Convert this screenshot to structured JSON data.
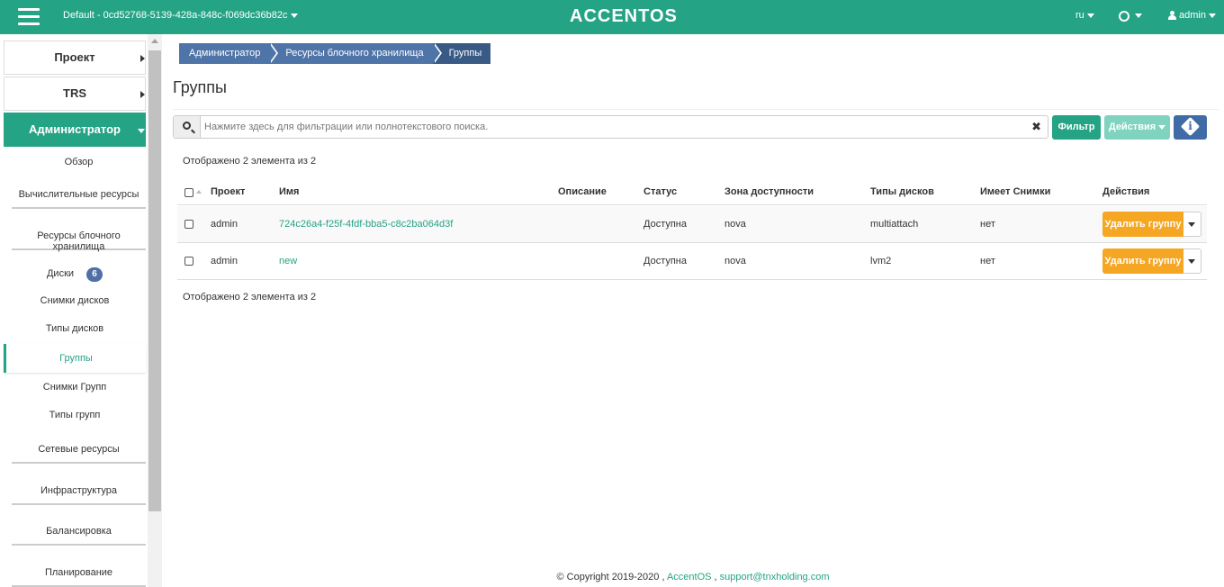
{
  "header": {
    "project_label": "Default - 0cd52768-5139-428a-848c-f069dc36b82c",
    "logo": "ACCENTOS",
    "lang": "ru",
    "user": "admin",
    "brand_color": "#25a385"
  },
  "sidebar": {
    "main_items": [
      {
        "label": "Проект"
      },
      {
        "label": "TRS"
      },
      {
        "label": "Администратор"
      }
    ],
    "admin_items": [
      {
        "label": "Обзор"
      },
      {
        "label": "Вычислительные ресурсы"
      },
      {
        "label": "Ресурсы блочного хранилища"
      },
      {
        "label": "Сетевые ресурсы"
      },
      {
        "label": "Инфраструктура"
      },
      {
        "label": "Балансировка"
      },
      {
        "label": "Планирование"
      }
    ],
    "storage_items": [
      {
        "label": "Диски",
        "badge": "6"
      },
      {
        "label": "Снимки дисков"
      },
      {
        "label": "Типы дисков"
      },
      {
        "label": "Группы"
      },
      {
        "label": "Снимки Групп"
      },
      {
        "label": "Типы групп"
      }
    ]
  },
  "breadcrumb": [
    "Администратор",
    "Ресурсы блочного хранилища",
    "Группы"
  ],
  "page_title": "Группы",
  "search": {
    "placeholder": "Нажмите здесь для фильтрации или полнотекстового поиска."
  },
  "buttons": {
    "filter": "Фильтр",
    "actions": "Действия"
  },
  "count_text": "Отображено 2 элемента из 2",
  "table": {
    "headers": [
      "Проект",
      "Имя",
      "Описание",
      "Статус",
      "Зона доступности",
      "Типы дисков",
      "Имеет Снимки",
      "Действия"
    ],
    "rows": [
      {
        "project": "admin",
        "name": "724c26a4-f25f-4fdf-bba5-c8c2ba064d3f",
        "description": "",
        "status": "Доступна",
        "zone": "nova",
        "types": "multiattach",
        "has_snapshots": "нет",
        "action": "Удалить группу"
      },
      {
        "project": "admin",
        "name": "new",
        "description": "",
        "status": "Доступна",
        "zone": "nova",
        "types": "lvm2",
        "has_snapshots": "нет",
        "action": "Удалить группу"
      }
    ]
  },
  "footer": {
    "copyright": "© Copyright 2019-2020 ,",
    "brand_link": "AccentOS",
    "separator": ",",
    "email": "support@tnxholding.com"
  }
}
